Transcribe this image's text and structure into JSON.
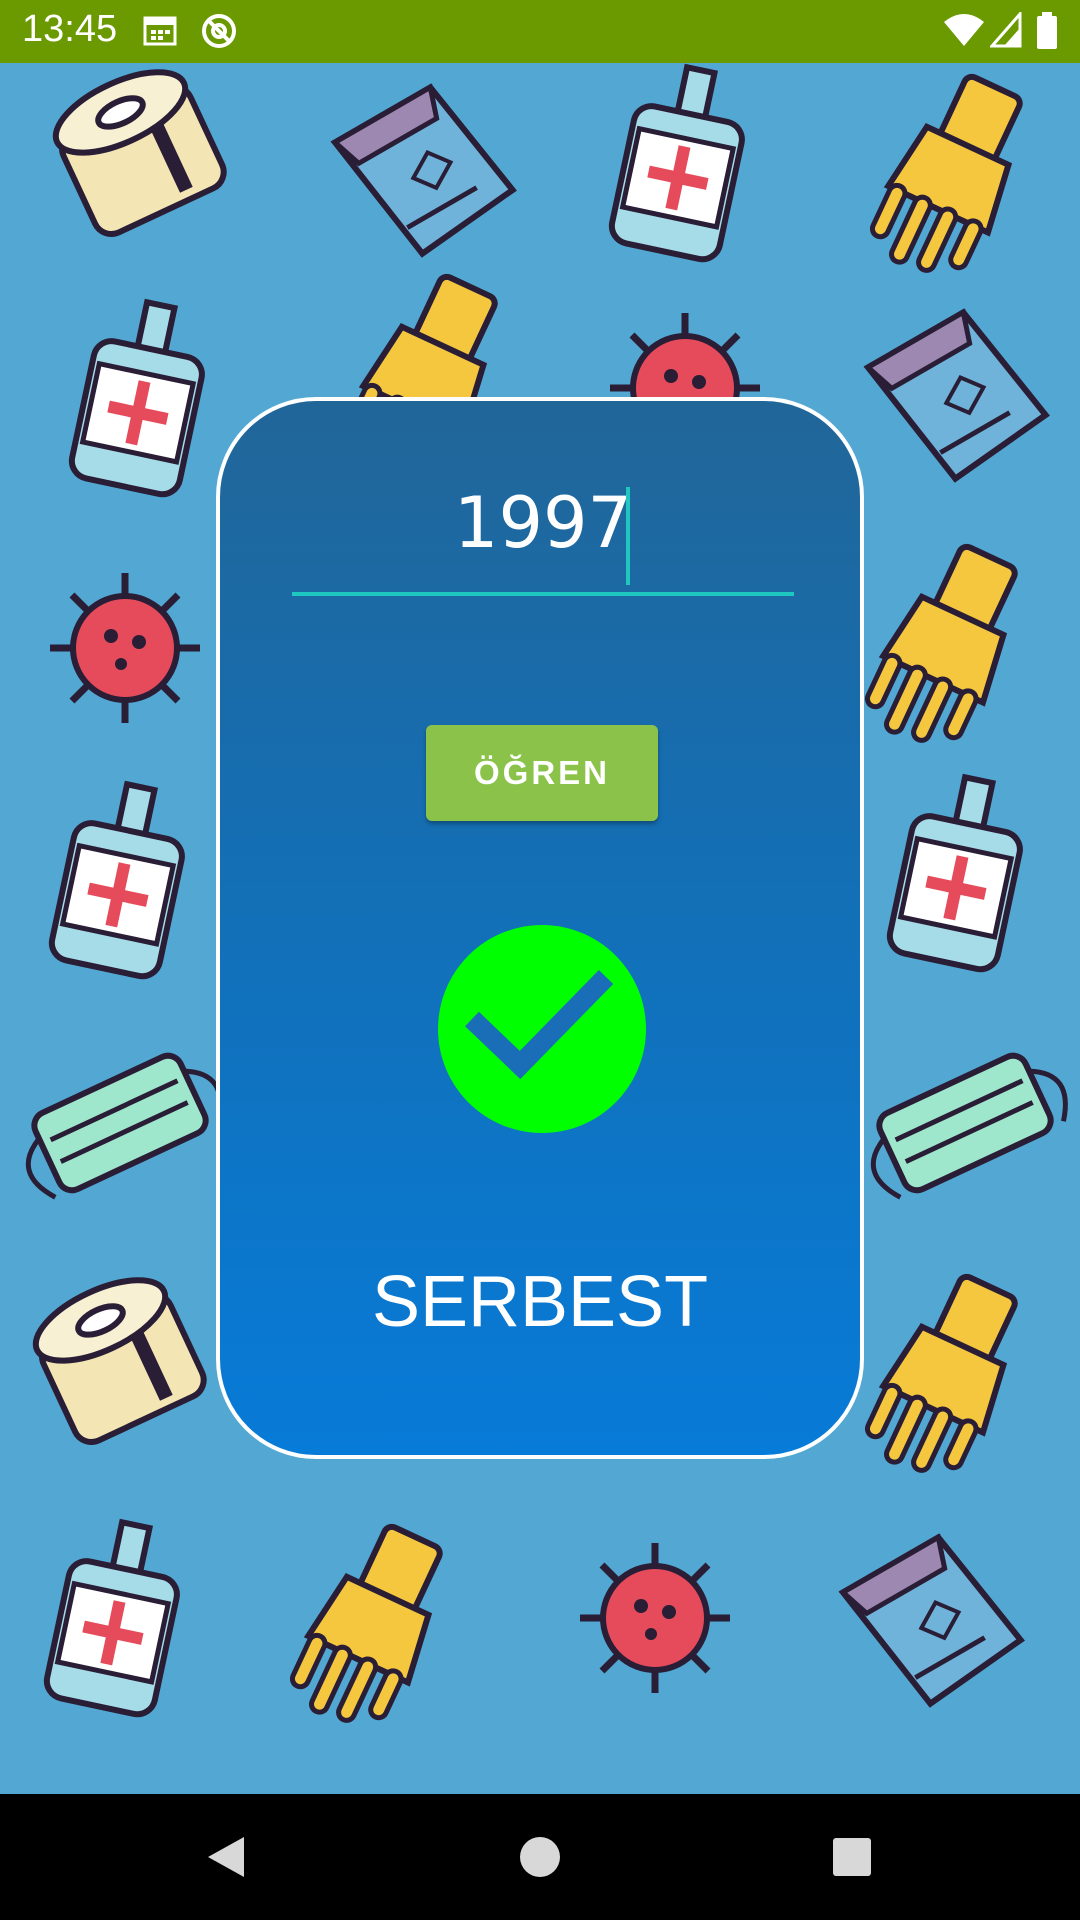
{
  "status_bar": {
    "time": "13:45",
    "icons": [
      "calendar-icon",
      "at-sign-icon",
      "wifi-icon",
      "signal-icon",
      "battery-icon"
    ],
    "background_color": "#6a9a00"
  },
  "background": {
    "color": "#52a8d2",
    "pattern_icons": [
      "toilet-paper-icon",
      "tissue-box-icon",
      "sanitizer-bottle-icon",
      "glove-icon",
      "virus-icon",
      "face-mask-icon"
    ]
  },
  "card": {
    "year_input": {
      "value": "1997",
      "underline_color": "#1ec8c0"
    },
    "learn_button": {
      "label": "ÖĞREN",
      "color": "#8bc34a"
    },
    "status_icon": {
      "name": "check-circle-icon",
      "color": "#00ff00"
    },
    "status_text": "SERBEST"
  },
  "nav_bar": {
    "buttons": [
      "back-icon",
      "home-icon",
      "recents-icon"
    ]
  }
}
